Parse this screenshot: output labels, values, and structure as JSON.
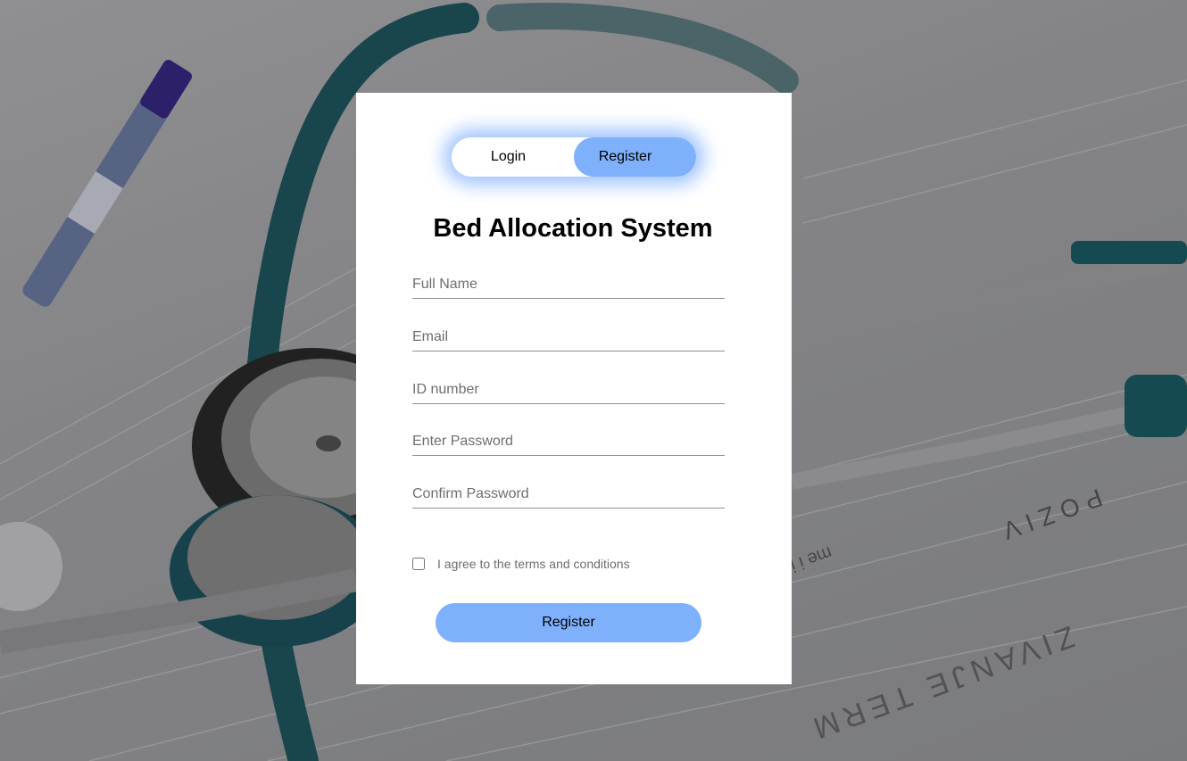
{
  "toggle": {
    "login_label": "Login",
    "register_label": "Register",
    "active": "Register"
  },
  "title": "Bed Allocation System",
  "form": {
    "full_name_placeholder": "Full Name",
    "email_placeholder": "Email",
    "id_placeholder": "ID number",
    "password_placeholder": "Enter Password",
    "confirm_placeholder": "Confirm Password",
    "terms_label": "I agree to the terms and conditions",
    "terms_checked": false,
    "submit_label": "Register"
  },
  "colors": {
    "accent": "#7fb0fb",
    "card": "#ffffff",
    "text": "#000000",
    "placeholder": "#6e6e6e"
  },
  "background": {
    "description_icon": "stethoscope-photo",
    "letters_bottom": "ZIVANJE TERM",
    "letters_mid": "POZIV",
    "letters_small": "me i ime"
  }
}
